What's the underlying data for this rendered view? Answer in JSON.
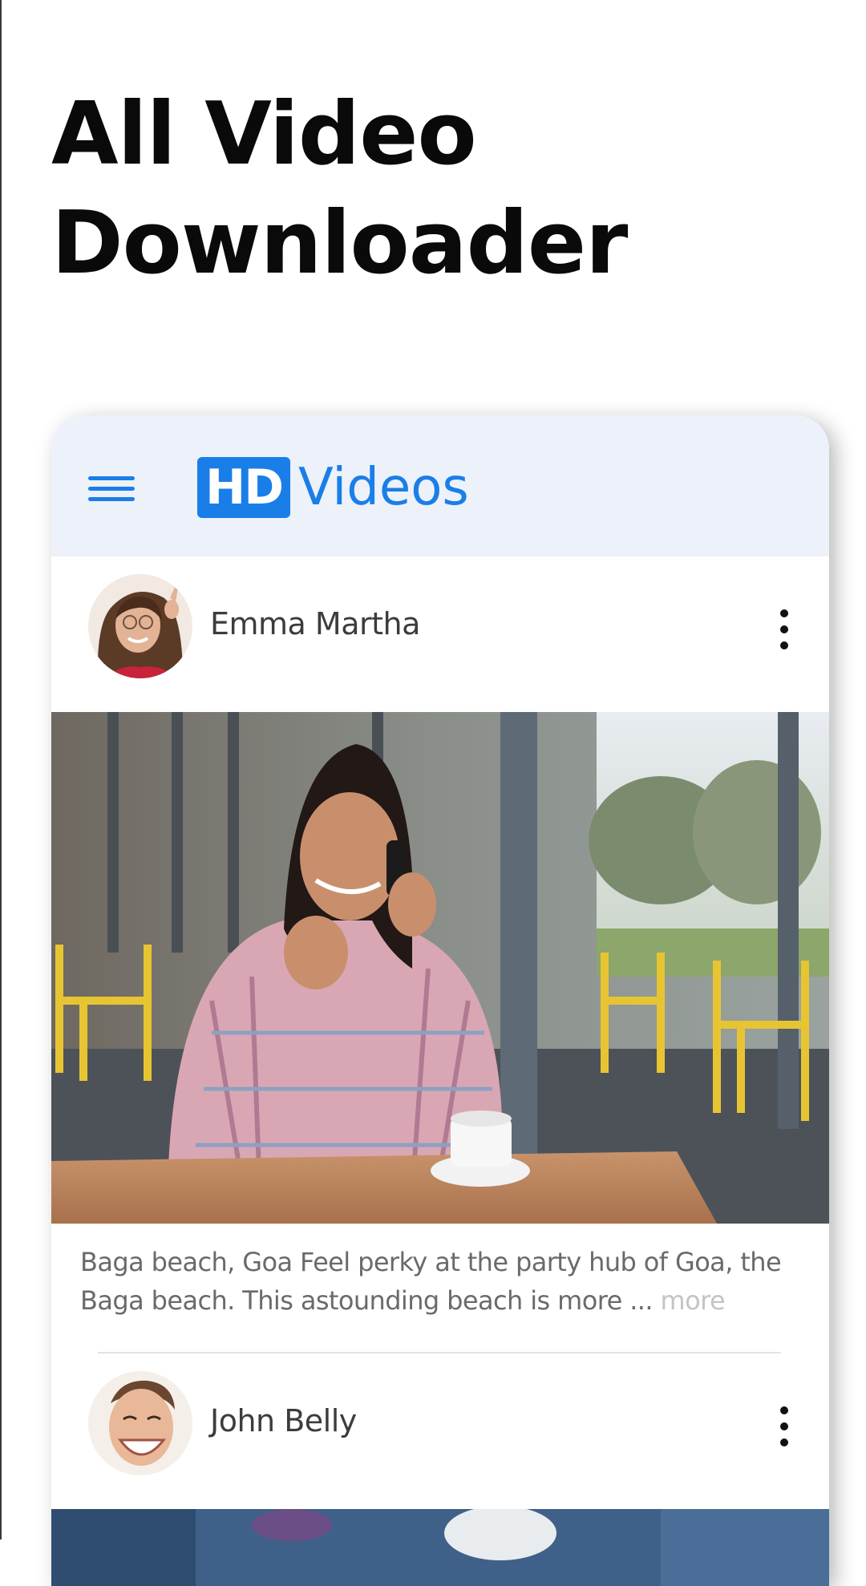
{
  "headline": {
    "line1": "All Video",
    "line2": "Downloader"
  },
  "app_bar": {
    "logo_badge": "HD",
    "logo_text": "Videos",
    "menu_icon": "hamburger-menu-icon",
    "accent_color": "#1a7ee8",
    "background_color": "#edf1f9"
  },
  "feed": {
    "posts": [
      {
        "user_name": "Emma Martha",
        "caption": "Baga beach, Goa Feel perky at the party hub of Goa, the Baga beach. This astounding beach is more ...",
        "more_label": "more",
        "options_icon": "more-vertical-icon"
      },
      {
        "user_name": "John Belly",
        "options_icon": "more-vertical-icon"
      }
    ]
  }
}
